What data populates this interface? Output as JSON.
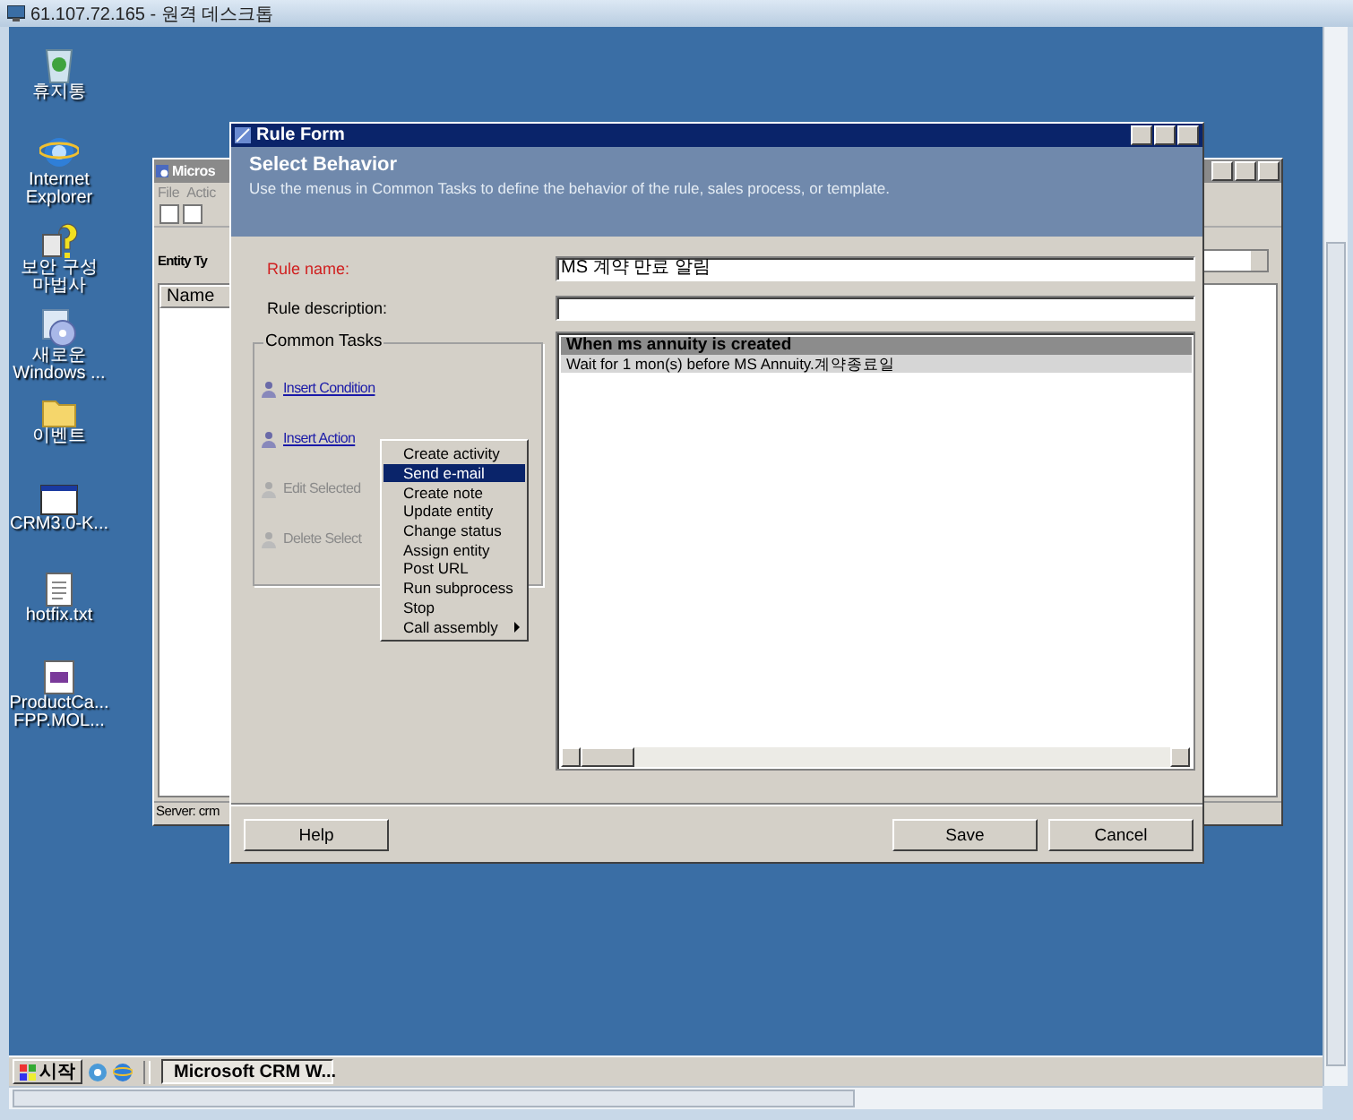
{
  "remote_window": {
    "title": "61.107.72.165 - 원격 데스크톱"
  },
  "desktop_icons": [
    {
      "kind": "recycle",
      "lines": [
        "휴지통"
      ]
    },
    {
      "kind": "browser",
      "lines": [
        "Internet",
        "Explorer"
      ]
    },
    {
      "kind": "wizard",
      "lines": [
        "보안 구성",
        "마법사"
      ]
    },
    {
      "kind": "media",
      "lines": [
        "새로운",
        "Windows ..."
      ]
    },
    {
      "kind": "folder",
      "lines": [
        "이벤트"
      ]
    },
    {
      "kind": "window",
      "lines": [
        "CRM3.0-K..."
      ]
    },
    {
      "kind": "text",
      "lines": [
        "hotfix.txt"
      ]
    },
    {
      "kind": "document",
      "lines": [
        "ProductCa...",
        "FPP.MOL..."
      ]
    }
  ],
  "background_window": {
    "title": "Micros",
    "menu": [
      "File",
      "Actic"
    ],
    "entity_label": "Entity Ty",
    "column": "Name",
    "status": "Server: crm"
  },
  "rule_form": {
    "title": "Rule Form",
    "header_title": "Select Behavior",
    "header_text": "Use the menus in Common Tasks to define the behavior of the rule, sales process, or template.",
    "rule_name_label": "Rule name:",
    "rule_name_value": "MS 계약 만료 알림",
    "description_label": "Rule description:",
    "common_tasks_title": "Common Tasks",
    "tasks": [
      {
        "label": "Insert Condition",
        "disabled": false
      },
      {
        "label": "Insert Action",
        "disabled": false
      },
      {
        "label": "Edit Selected",
        "disabled": true
      },
      {
        "label": "Delete Select",
        "disabled": true
      }
    ],
    "steps": [
      {
        "kind": "trigger",
        "text": "When ms annuity is created"
      },
      {
        "kind": "action",
        "text": "Wait for 1 mon(s) before MS Annuity.계약종료일"
      }
    ],
    "buttons": [
      {
        "label": "Help"
      },
      {
        "label": "Save"
      },
      {
        "label": "Cancel"
      }
    ]
  },
  "context_menu": {
    "items": [
      {
        "label": "Create activity",
        "selected": false,
        "has_submenu": false
      },
      {
        "label": "Send e-mail",
        "selected": true,
        "has_submenu": false
      },
      {
        "label": "Create note",
        "selected": false,
        "has_submenu": false
      },
      {
        "label": "Update entity",
        "selected": false,
        "has_submenu": false
      },
      {
        "label": "Change status",
        "selected": false,
        "has_submenu": false
      },
      {
        "label": "Assign entity",
        "selected": false,
        "has_submenu": false
      },
      {
        "label": "Post URL",
        "selected": false,
        "has_submenu": false
      },
      {
        "label": "Run subprocess",
        "selected": false,
        "has_submenu": false
      },
      {
        "label": "Stop",
        "selected": false,
        "has_submenu": false
      },
      {
        "label": "Call assembly",
        "selected": false,
        "has_submenu": true
      }
    ]
  },
  "taskbar": {
    "start": "시작",
    "tasks": [
      {
        "label": "Microsoft CRM W...",
        "selected": true
      }
    ]
  }
}
